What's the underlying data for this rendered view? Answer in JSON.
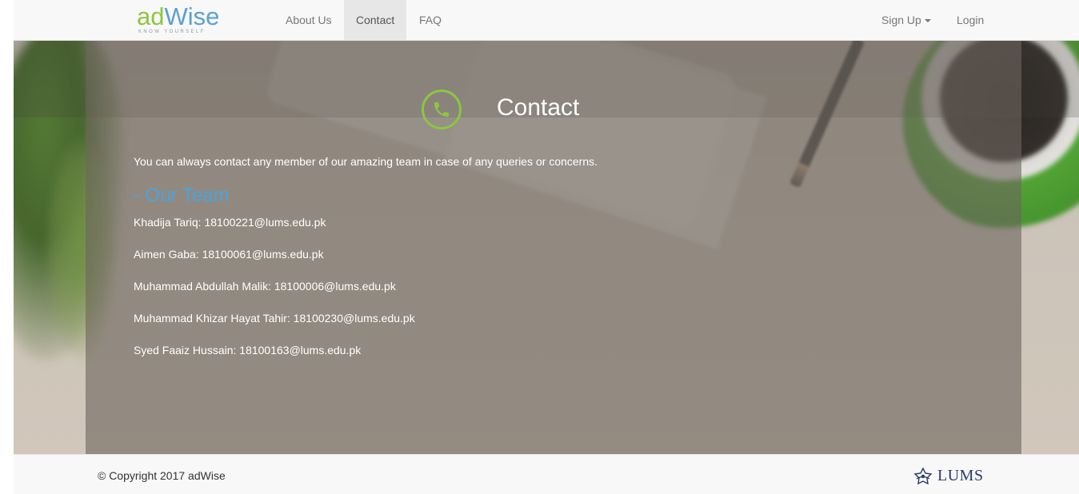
{
  "navbar": {
    "brand": {
      "main_prefix": "ad",
      "main_suffix": "Wise",
      "tagline": "KNOW YOURSELF"
    },
    "links": [
      {
        "label": "About Us"
      },
      {
        "label": "Contact",
        "active": true
      },
      {
        "label": "FAQ"
      }
    ],
    "right": {
      "signup_label": "Sign Up",
      "login_label": "Login"
    }
  },
  "hero": {
    "title": "Contact",
    "icon": "phone-icon",
    "intro": "You can always contact any member of our amazing team in case of any queries or concerns.",
    "team_heading": "- Our Team",
    "members": [
      "Khadija Tariq: 18100221@lums.edu.pk",
      "Aimen Gaba: 18100061@lums.edu.pk",
      "Muhammad Abdullah Malik: 18100006@lums.edu.pk",
      "Muhammad Khizar Hayat Tahir: 18100230@lums.edu.pk",
      "Syed Faaiz Hussain: 18100163@lums.edu.pk"
    ]
  },
  "footer": {
    "copyright": "© Copyright 2017 adWise",
    "partner_logo": "LUMS"
  },
  "colors": {
    "accent_green": "#8cc63f",
    "heading_blue": "#4aa3df",
    "navbar_bg": "#f8f8f8"
  }
}
